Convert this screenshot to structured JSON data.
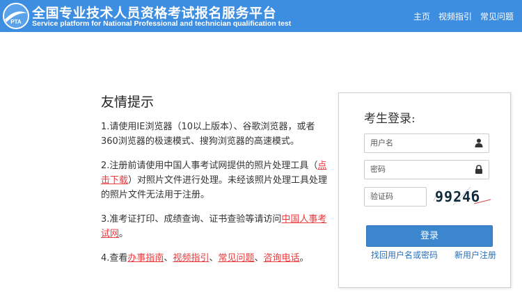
{
  "header": {
    "logo_text": "PTA",
    "title_cn": "全国专业技术人员资格考试报名服务平台",
    "title_en": "Service platform for National Professional and technician qualification test",
    "nav": [
      {
        "label": "主页"
      },
      {
        "label": "视频指引"
      },
      {
        "label": "常见问题"
      }
    ]
  },
  "tips": {
    "title": "友情提示",
    "items": [
      {
        "pre": "1.请使用IE浏览器（10以上版本）、谷歌浏览器，或者360浏览器的极速模式、搜狗浏览器的高速模式。"
      },
      {
        "pre": "2.注册前请使用中国人事考试网提供的照片处理工具（",
        "link": "点击下载",
        "post": "）对照片文件进行处理。未经该照片处理工具处理的照片文件无法用于注册。"
      },
      {
        "pre": "3.准考证打印、成绩查询、证书查验等请访问",
        "link": "中国人事考试网",
        "post": "。"
      },
      {
        "pre": "4.查看",
        "link1": "办事指南",
        "sep1": "、",
        "link2": "视频指引",
        "sep2": "、",
        "link3": "常见问题",
        "sep3": "、",
        "link4": "咨询电话",
        "post": "。"
      }
    ]
  },
  "login": {
    "title": "考生登录:",
    "username_placeholder": "用户名",
    "password_placeholder": "密码",
    "captcha_placeholder": "验证码",
    "captcha_code": "9924б",
    "login_button": "登录",
    "forgot_link": "找回用户名或密码",
    "register_link": "新用户注册"
  },
  "colors": {
    "header_bg": "#3d8ee0",
    "link_red": "#e8393c",
    "button_blue": "#3c86cd",
    "link_blue": "#2a6fb8"
  }
}
